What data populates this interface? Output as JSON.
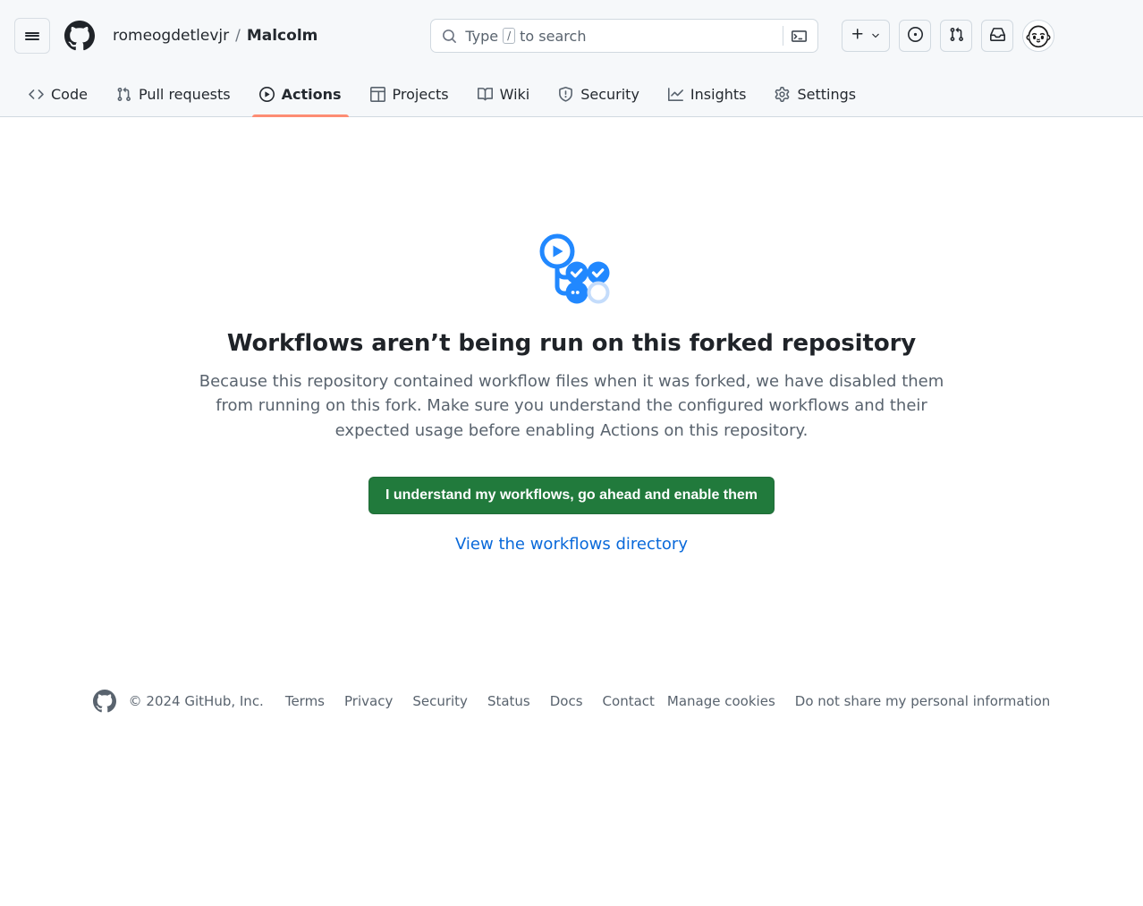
{
  "header": {
    "menu_icon": "hamburger-icon",
    "logo_icon": "github-logo-icon",
    "breadcrumb": {
      "owner": "romeogdetlevjr",
      "separator": "/",
      "repo": "Malcolm"
    },
    "search": {
      "icon": "search-icon",
      "placeholder_prefix": "Type",
      "placeholder_key": "/",
      "placeholder_suffix": "to search",
      "command_icon": "terminal-icon"
    },
    "actions": [
      {
        "name": "create-new-button",
        "icon": "plus-icon"
      },
      {
        "name": "issues-button",
        "icon": "issue-opened-icon"
      },
      {
        "name": "pull-requests-button",
        "icon": "git-pull-request-icon"
      },
      {
        "name": "notifications-button",
        "icon": "inbox-icon"
      },
      {
        "name": "user-avatar",
        "icon": "avatar-icon"
      }
    ]
  },
  "repo_nav": {
    "items": [
      {
        "label": "Code",
        "icon": "code-icon",
        "selected": false
      },
      {
        "label": "Pull requests",
        "icon": "git-pull-request-icon",
        "selected": false
      },
      {
        "label": "Actions",
        "icon": "play-icon",
        "selected": true
      },
      {
        "label": "Projects",
        "icon": "table-icon",
        "selected": false
      },
      {
        "label": "Wiki",
        "icon": "book-icon",
        "selected": false
      },
      {
        "label": "Security",
        "icon": "shield-icon",
        "selected": false
      },
      {
        "label": "Insights",
        "icon": "graph-icon",
        "selected": false
      },
      {
        "label": "Settings",
        "icon": "gear-icon",
        "selected": false
      }
    ],
    "active_underline_color": "#fd8c73"
  },
  "main": {
    "illustration": "workflow-diagram-icon",
    "title": "Workflows aren’t being run on this forked repository",
    "description": "Because this repository contained workflow files when it was forked, we have disabled them from running on this fork. Make sure you understand the configured workflows and their expected usage before enabling Actions on this repository.",
    "enable_button_label": "I understand my workflows, go ahead and enable them",
    "enable_button_color": "#217a3c",
    "link_label": "View the workflows directory",
    "link_color": "#0969da"
  },
  "footer": {
    "mark_icon": "github-mark-icon",
    "copyright": "© 2024 GitHub, Inc.",
    "links": [
      "Terms",
      "Privacy",
      "Security",
      "Status",
      "Docs",
      "Contact",
      "Manage cookies",
      "Do not share my personal information"
    ]
  }
}
